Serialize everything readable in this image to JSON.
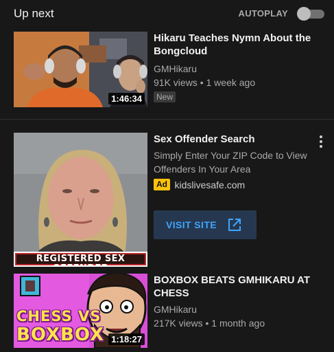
{
  "header": {
    "title": "Up next",
    "autoplay_label": "AUTOPLAY",
    "autoplay_on": false
  },
  "videos": [
    {
      "title": "Hikaru Teaches Nymn About the Bongcloud",
      "channel": "GMHikaru",
      "views": "91K views",
      "age": "1 week ago",
      "meta_sep": " • ",
      "badge": "New",
      "duration": "1:46:34"
    },
    {
      "title": "BOXBOX BEATS GMHIKARU AT CHESS",
      "channel": "GMHikaru",
      "views": "217K views",
      "age": "1 month ago",
      "meta_sep": " • ",
      "duration": "1:18:27",
      "thumb_text_1": "CHESS VS",
      "thumb_text_2": "BOXBOX"
    }
  ],
  "ad": {
    "title": "Sex Offender Search",
    "description": "Simply Enter Your ZIP Code to View Offenders In Your Area",
    "badge": "Ad",
    "domain": "kidslivesafe.com",
    "cta": "VISIT SITE",
    "banner": "REGISTERED SEX OFFENDER"
  },
  "colors": {
    "background": "#181818",
    "accent": "#3ea6ff",
    "ad_badge": "#fcc30b"
  }
}
